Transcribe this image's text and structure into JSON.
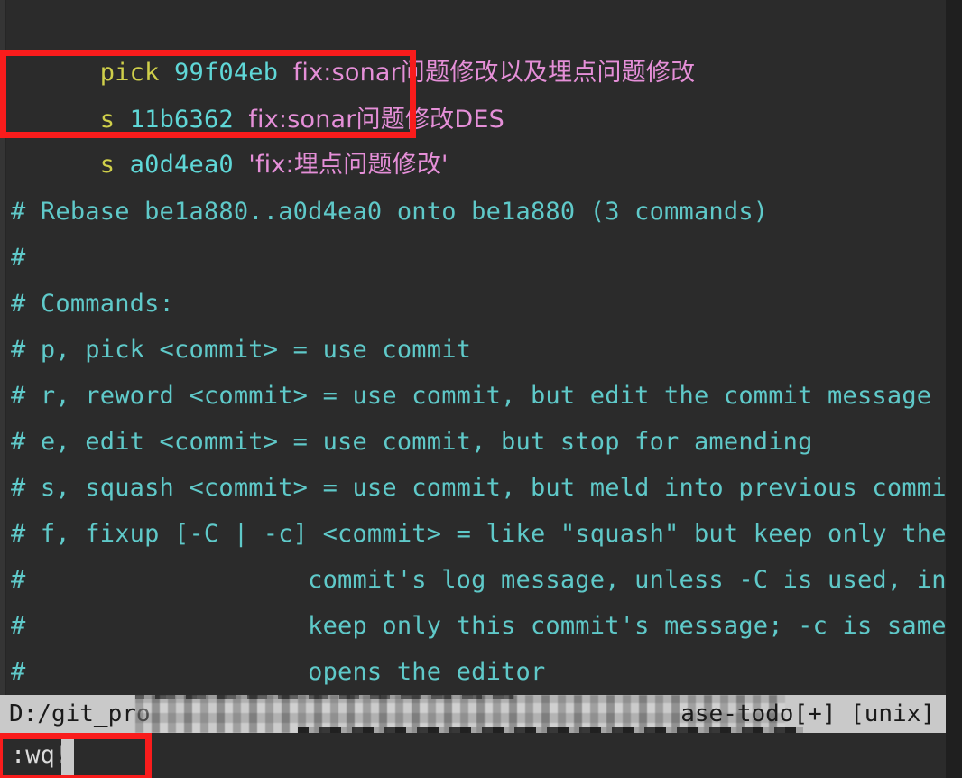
{
  "editor": {
    "name": "vim",
    "background": "#2b2b2b",
    "comment_color": "#5fc9c9",
    "command_color": "#cfcf4a",
    "hash_color": "#5fd7d7",
    "message_color": "#e58fd8",
    "annotation_color": "#f91c1c"
  },
  "todo_lines": [
    {
      "command": "pick",
      "hash": "99f04eb",
      "message": "fix:sonar问题修改以及埋点问题修改"
    },
    {
      "command": "s",
      "hash": "11b6362",
      "message": "fix:sonar问题修改DES"
    },
    {
      "command": "s",
      "hash": "a0d4ea0",
      "message": "'fix:埋点问题修改'"
    }
  ],
  "comments": [
    "# Rebase be1a880..a0d4ea0 onto be1a880 (3 commands)",
    "#",
    "# Commands:",
    "# p, pick <commit> = use commit",
    "# r, reword <commit> = use commit, but edit the commit message",
    "# e, edit <commit> = use commit, but stop for amending",
    "# s, squash <commit> = use commit, but meld into previous commit",
    "# f, fixup [-C | -c] <commit> = like \"squash\" but keep only the previous",
    "#                   commit's log message, unless -C is used, in which case",
    "#                   keep only this commit's message; -c is same as -C but",
    "#                   opens the editor"
  ],
  "statusline": {
    "path_prefix": "D:/git_pro",
    "path_suffix": "ase-todo[+]",
    "file_format": "[unix]",
    "redacted": true
  },
  "commandline": {
    "text": ":wq!",
    "cursor": "block"
  },
  "annotations": [
    {
      "name": "squash-lines-highlight",
      "label": ""
    },
    {
      "name": "write-quit-command-highlight",
      "label": ""
    }
  ]
}
